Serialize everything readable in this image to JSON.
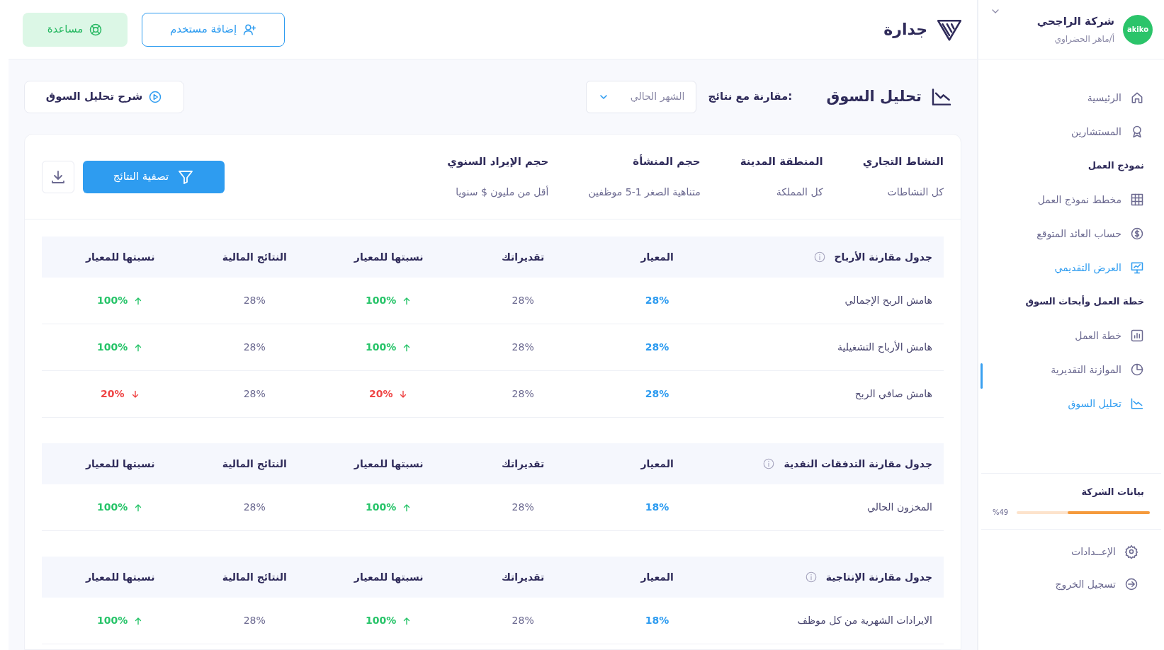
{
  "company": {
    "name": "شركة الراجحي",
    "user": "أ/ماهر الحضراوي",
    "logo_text": "akiko"
  },
  "brand": {
    "name": "جدارة"
  },
  "header_buttons": [
    {
      "kind": "add_user",
      "label": "إضافة مستخدم"
    },
    {
      "kind": "help",
      "label": "مساعدة"
    }
  ],
  "sidebar": {
    "items": [
      {
        "kind": "item",
        "label": "الرئيسية",
        "selected": false
      },
      {
        "kind": "item",
        "label": "المستشارين",
        "selected": false
      },
      {
        "kind": "section",
        "label": "نموذج العمل"
      },
      {
        "kind": "item",
        "label": "مخطط نموذج العمل",
        "selected": false
      },
      {
        "kind": "item",
        "label": "حساب العائد المتوقع",
        "selected": false
      },
      {
        "kind": "item",
        "label": "العرض التقديمي",
        "selected": true
      },
      {
        "kind": "section",
        "label": "خطة العمل وأبحاث السوق"
      },
      {
        "kind": "item",
        "label": "خطة العمل",
        "selected": false
      },
      {
        "kind": "item",
        "label": "الموازنة التقديرية",
        "selected": false
      },
      {
        "kind": "item",
        "label": "تحليل السوق",
        "selected": true
      }
    ],
    "company_data": {
      "title": "بيانات الشركة",
      "reading": "%49",
      "level": 0.62
    },
    "footer_items": [
      {
        "label": "الإعــدادات"
      },
      {
        "label": "تسجيل الخروج"
      }
    ]
  },
  "page": {
    "title": "تحليل السوق",
    "compare_label": ":مقارنة مع نتائج",
    "compare_value": "الشهر الحالي",
    "explain_button": "شرح تحليل السوق"
  },
  "filters": [
    {
      "label": "النشاط التجاري",
      "value": "كل النشاطات"
    },
    {
      "label": "المنطقة المدينة",
      "value": "كل المملكة"
    },
    {
      "label": "حجم المنشأة",
      "value": "متناهية الصغر 1-5 موظفين"
    },
    {
      "label": "حجم الإيراد السنوي",
      "value": "أقل من مليون $ سنويا"
    }
  ],
  "filter_button": "تصفية النتائج",
  "tables": [
    {
      "title": "جدول مقارنة الأرباح",
      "columns": [
        "المعيار",
        "تقديراتك",
        "نسبتها للمعيار",
        "النتائج المالية",
        "نسبتها للمعيار"
      ],
      "rows": [
        {
          "label": "هامش الربح الإجمالي",
          "cells": [
            {
              "kind": "benchmark",
              "text": "28%"
            },
            {
              "kind": "plain",
              "text": "28%"
            },
            {
              "kind": "up",
              "text": "100%"
            },
            {
              "kind": "plain",
              "text": "28%"
            },
            {
              "kind": "up",
              "text": "100%"
            }
          ]
        },
        {
          "label": "هامش الأرباح التشغيلية",
          "cells": [
            {
              "kind": "benchmark",
              "text": "28%"
            },
            {
              "kind": "plain",
              "text": "28%"
            },
            {
              "kind": "up",
              "text": "100%"
            },
            {
              "kind": "plain",
              "text": "28%"
            },
            {
              "kind": "up",
              "text": "100%"
            }
          ]
        },
        {
          "label": "هامش صافي الربح",
          "cells": [
            {
              "kind": "benchmark",
              "text": "28%"
            },
            {
              "kind": "plain",
              "text": "28%"
            },
            {
              "kind": "down",
              "text": "20%"
            },
            {
              "kind": "plain",
              "text": "28%"
            },
            {
              "kind": "down",
              "text": "20%"
            }
          ]
        }
      ]
    },
    {
      "title": "جدول مقارنة التدفقات النقدية",
      "columns": [
        "المعيار",
        "تقديراتك",
        "نسبتها للمعيار",
        "النتائج المالية",
        "نسبتها للمعيار"
      ],
      "rows": [
        {
          "label": "المخزون الحالي",
          "cells": [
            {
              "kind": "benchmark",
              "text": "18%"
            },
            {
              "kind": "plain",
              "text": "28%"
            },
            {
              "kind": "up",
              "text": "100%"
            },
            {
              "kind": "plain",
              "text": "28%"
            },
            {
              "kind": "up",
              "text": "100%"
            }
          ]
        }
      ]
    },
    {
      "title": "جدول مقارنة الإنتاجية",
      "columns": [
        "المعيار",
        "تقديراتك",
        "نسبتها للمعيار",
        "النتائج المالية",
        "نسبتها للمعيار"
      ],
      "rows": [
        {
          "label": "الايرادات الشهرية من كل موظف",
          "cells": [
            {
              "kind": "benchmark",
              "text": "18%"
            },
            {
              "kind": "plain",
              "text": "28%"
            },
            {
              "kind": "up",
              "text": "100%"
            },
            {
              "kind": "plain",
              "text": "28%"
            },
            {
              "kind": "up",
              "text": "100%"
            }
          ]
        }
      ]
    }
  ]
}
